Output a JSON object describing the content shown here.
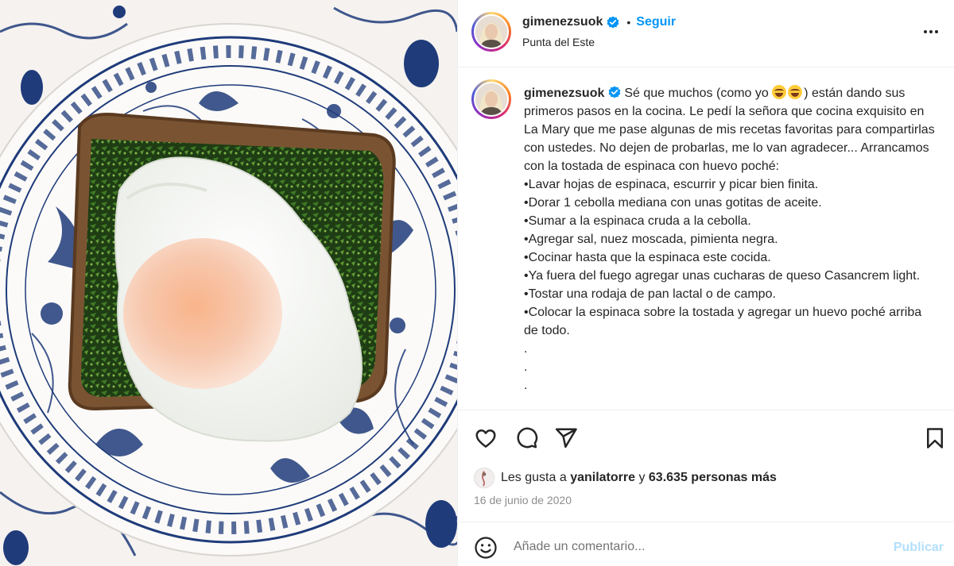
{
  "photo": {
    "subject": "poached egg on spinach toast on blue floral plate"
  },
  "header": {
    "username": "gimenezsuok",
    "separator": "•",
    "follow_label": "Seguir",
    "location": "Punta del Este"
  },
  "caption": {
    "username": "gimenezsuok",
    "intro_before_emoji": "Sé que muchos (como yo ",
    "intro_after_emoji": ") están dando sus primeros pasos en la cocina. Le pedí la señora que cocina exquisito en La Mary que me pase algunas de mis recetas favoritas para compartirlas con ustedes. No dejen de probarlas, me lo van agradecer... Arrancamos con la tostada de espinaca con huevo poché:",
    "steps": [
      "•Lavar hojas de espinaca, escurrir y picar bien finita.",
      "•Dorar 1 cebolla mediana con unas gotitas de aceite.",
      "•Sumar a la espinaca cruda a la cebolla.",
      "•Agregar sal, nuez moscada, pimienta negra.",
      "•Cocinar hasta que la espinaca este cocida.",
      "•Ya fuera del fuego agregar unas cucharas de queso Casancrem light. •Tostar una rodaja de pan lactal o de campo.",
      "•Colocar la espinaca sobre la tostada y agregar un huevo poché arriba de todo.",
      ".",
      ".",
      "."
    ]
  },
  "actions": {
    "like_icon": "heart-icon",
    "comment_icon": "comment-icon",
    "share_icon": "share-icon",
    "save_icon": "bookmark-icon"
  },
  "likes": {
    "prefix": "Les gusta a",
    "user": "yanilatorre",
    "conjunction": "y",
    "others": "63.635 personas más"
  },
  "date": "16 de junio de 2020",
  "comment_box": {
    "placeholder": "Añade un comentario...",
    "publish_label": "Publicar"
  },
  "colors": {
    "accent": "#0095f6",
    "publish_disabled": "#b2dffc",
    "text": "#262626",
    "muted": "#8e8e8e",
    "plate_blue": "#1f3b7a"
  }
}
